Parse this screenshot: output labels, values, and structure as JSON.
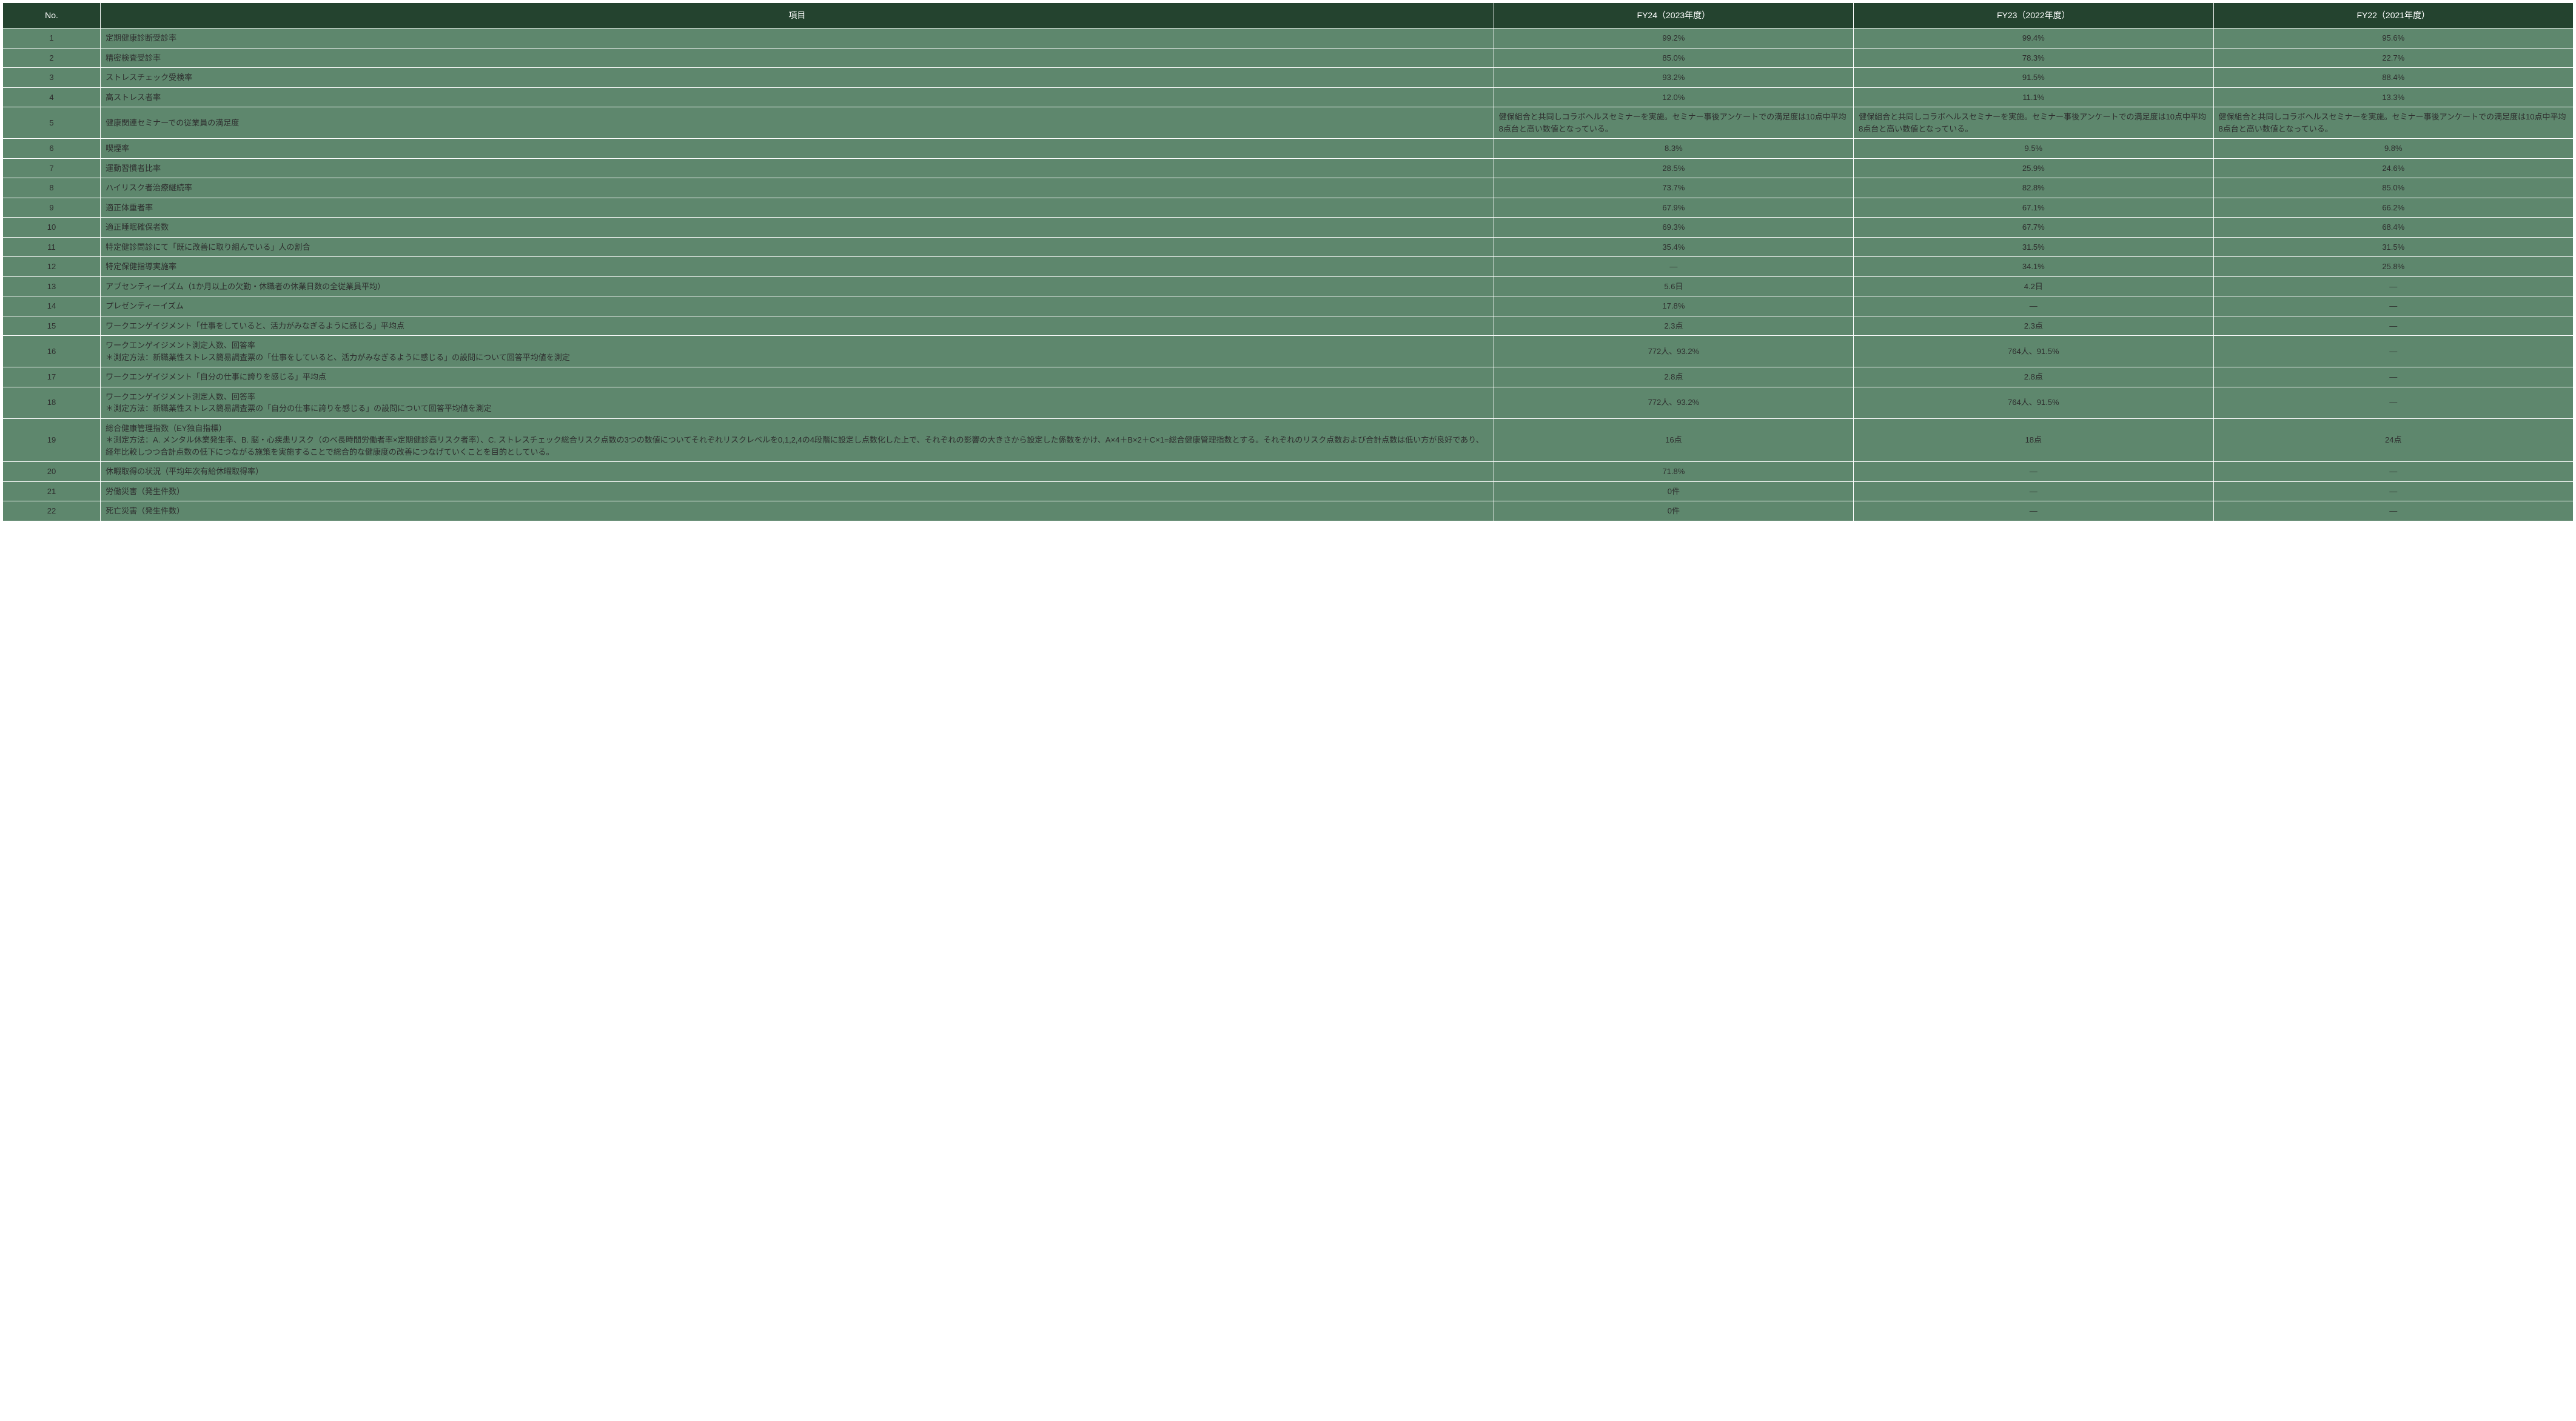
{
  "headers": {
    "no": "No.",
    "item": "項目",
    "fy24": "FY24（2023年度）",
    "fy23": "FY23（2022年度）",
    "fy22": "FY22（2021年度）"
  },
  "rows": [
    {
      "no": "1",
      "item": "定期健康診断受診率",
      "fy24": "99.2%",
      "fy23": "99.4%",
      "fy22": "95.6%"
    },
    {
      "no": "2",
      "item": "精密検査受診率",
      "fy24": "85.0%",
      "fy23": "78.3%",
      "fy22": "22.7%"
    },
    {
      "no": "3",
      "item": "ストレスチェック受検率",
      "fy24": "93.2%",
      "fy23": "91.5%",
      "fy22": "88.4%"
    },
    {
      "no": "4",
      "item": "高ストレス者率",
      "fy24": "12.0%",
      "fy23": "11.1%",
      "fy22": "13.3%"
    },
    {
      "no": "5",
      "item": "健康関連セミナーでの従業員の満足度",
      "fy24": "健保組合と共同しコラボヘルスセミナーを実施。セミナー事後アンケートでの満足度は10点中平均8点台と高い数値となっている。",
      "fy23": "健保組合と共同しコラボヘルスセミナーを実施。セミナー事後アンケートでの満足度は10点中平均8点台と高い数値となっている。",
      "fy22": "健保組合と共同しコラボヘルスセミナーを実施。セミナー事後アンケートでの満足度は10点中平均8点台と高い数値となっている。",
      "long": true
    },
    {
      "no": "6",
      "item": "喫煙率",
      "fy24": "8.3%",
      "fy23": "9.5%",
      "fy22": "9.8%"
    },
    {
      "no": "7",
      "item": "運動習慣者比率",
      "fy24": "28.5%",
      "fy23": "25.9%",
      "fy22": "24.6%"
    },
    {
      "no": "8",
      "item": "ハイリスク者治療継続率",
      "fy24": "73.7%",
      "fy23": "82.8%",
      "fy22": "85.0%"
    },
    {
      "no": "9",
      "item": "適正体重者率",
      "fy24": "67.9%",
      "fy23": "67.1%",
      "fy22": "66.2%"
    },
    {
      "no": "10",
      "item": "適正睡眠確保者数",
      "fy24": "69.3%",
      "fy23": "67.7%",
      "fy22": "68.4%"
    },
    {
      "no": "11",
      "item": "特定健診問診にて「既に改善に取り組んでいる」人の割合",
      "fy24": "35.4%",
      "fy23": "31.5%",
      "fy22": "31.5%"
    },
    {
      "no": "12",
      "item": "特定保健指導実施率",
      "fy24": "―",
      "fy23": "34.1%",
      "fy22": "25.8%"
    },
    {
      "no": "13",
      "item": "アブセンティーイズム（1か月以上の欠勤・休職者の休業日数の全従業員平均）",
      "fy24": "5.6日",
      "fy23": "4.2日",
      "fy22": "―"
    },
    {
      "no": "14",
      "item": "プレゼンティーイズム",
      "fy24": "17.8%",
      "fy23": "―",
      "fy22": "―"
    },
    {
      "no": "15",
      "item": "ワークエンゲイジメント「仕事をしていると、活力がみなぎるように感じる」平均点",
      "fy24": "2.3点",
      "fy23": "2.3点",
      "fy22": "―"
    },
    {
      "no": "16",
      "item": "ワークエンゲイジメント測定人数、回答率\n＊測定方法：新職業性ストレス簡易調査票の「仕事をしていると、活力がみなぎるように感じる」の設問について回答平均値を測定",
      "fy24": "772人、93.2%",
      "fy23": "764人、91.5%",
      "fy22": "―"
    },
    {
      "no": "17",
      "item": "ワークエンゲイジメント「自分の仕事に誇りを感じる」平均点",
      "fy24": "2.8点",
      "fy23": "2.8点",
      "fy22": "―"
    },
    {
      "no": "18",
      "item": "ワークエンゲイジメント測定人数、回答率\n＊測定方法：新職業性ストレス簡易調査票の「自分の仕事に誇りを感じる」の設問について回答平均値を測定",
      "fy24": "772人、93.2%",
      "fy23": "764人、91.5%",
      "fy22": "―"
    },
    {
      "no": "19",
      "item": "総合健康管理指数（EY独自指標）\n＊測定方法：A. メンタル休業発生率、B. 脳・心疾患リスク（のべ長時間労働者率×定期健診高リスク者率）、C. ストレスチェック総合リスク点数の3つの数値についてそれぞれリスクレベルを0,1,2,4の4段階に設定し点数化した上で、それぞれの影響の大きさから設定した係数をかけ、A×4＋B×2＋C×1=総合健康管理指数とする。それぞれのリスク点数および合計点数は低い方が良好であり、経年比較しつつ合計点数の低下につながる施策を実施することで総合的な健康度の改善につなげていくことを目的としている。",
      "fy24": "16点",
      "fy23": "18点",
      "fy22": "24点"
    },
    {
      "no": "20",
      "item": "休暇取得の状況（平均年次有給休暇取得率）",
      "fy24": "71.8%",
      "fy23": "―",
      "fy22": "―"
    },
    {
      "no": "21",
      "item": "労働災害（発生件数）",
      "fy24": "0件",
      "fy23": "―",
      "fy22": "―"
    },
    {
      "no": "22",
      "item": "死亡災害（発生件数）",
      "fy24": "0件",
      "fy23": "―",
      "fy22": "―"
    }
  ]
}
